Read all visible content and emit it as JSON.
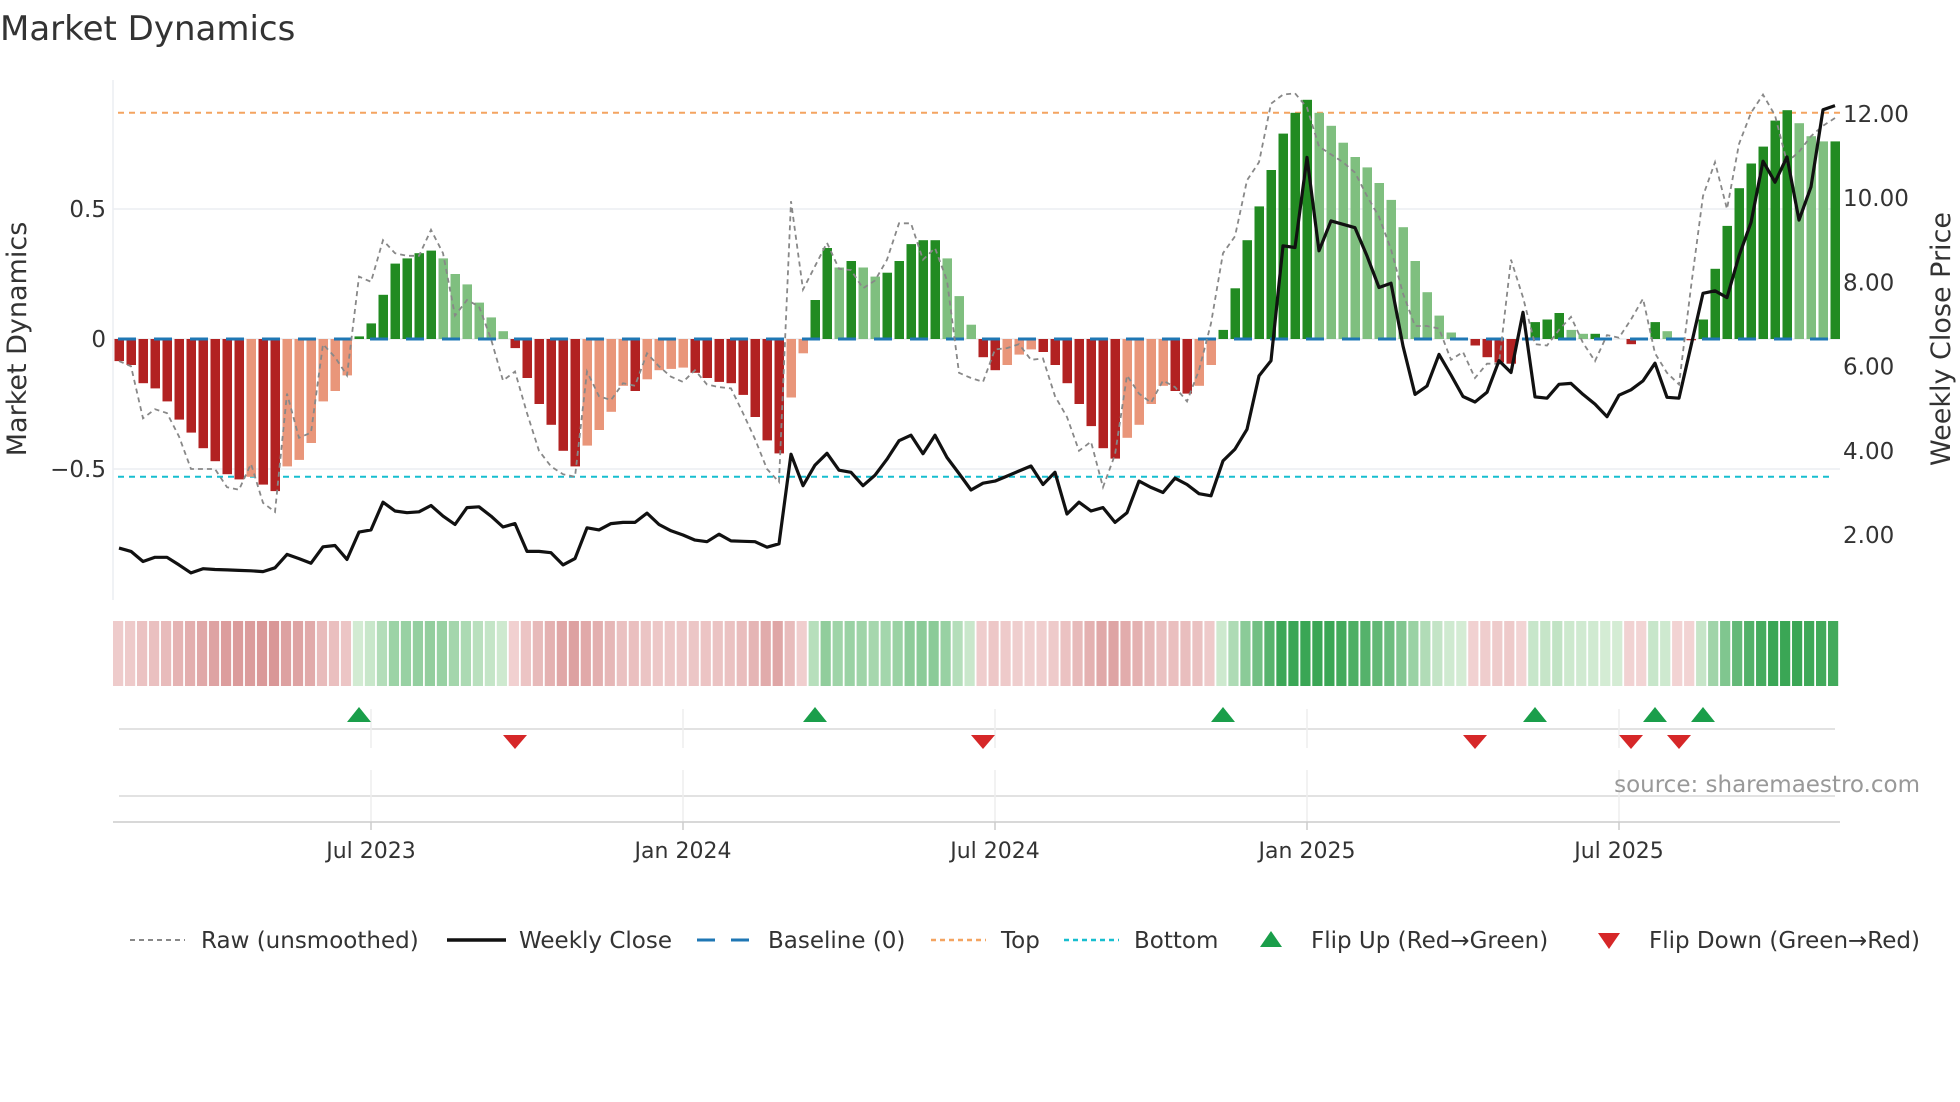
{
  "chart_data": {
    "type": "bar",
    "title": "Market Dynamics",
    "ylabel": "Market Dynamics",
    "y2label": "Weekly Close Price",
    "ylim": [
      -1.0,
      1.05
    ],
    "y2lim": [
      0.6,
      12.5
    ],
    "yticks": [
      {
        "v": 0.5,
        "label": "0.5"
      },
      {
        "v": 0,
        "label": "0"
      },
      {
        "v": -0.5,
        "label": "−0.5"
      }
    ],
    "y2ticks": [
      {
        "v": 12,
        "label": "12.00"
      },
      {
        "v": 10,
        "label": "10.00"
      },
      {
        "v": 8,
        "label": "8.00"
      },
      {
        "v": 6,
        "label": "6.00"
      },
      {
        "v": 4,
        "label": "4.00"
      },
      {
        "v": 2,
        "label": "2.00"
      }
    ],
    "xticks": [
      {
        "week": 22,
        "label": "Jul 2023"
      },
      {
        "week": 48,
        "label": "Jan 2024"
      },
      {
        "week": 74,
        "label": "Jul 2024"
      },
      {
        "week": 100,
        "label": "Jan 2025"
      },
      {
        "week": 126,
        "label": "Jul 2025"
      }
    ],
    "top_level": 0.87,
    "bottom_level": -0.53,
    "smoothed": [
      -0.085,
      -0.1,
      -0.17,
      -0.19,
      -0.24,
      -0.31,
      -0.36,
      -0.42,
      -0.47,
      -0.52,
      -0.54,
      -0.53,
      -0.56,
      -0.585,
      -0.49,
      -0.465,
      -0.4,
      -0.24,
      -0.2,
      -0.14,
      0.01,
      0.06,
      0.17,
      0.29,
      0.31,
      0.33,
      0.34,
      0.31,
      0.25,
      0.21,
      0.14,
      0.083,
      0.03,
      -0.035,
      -0.15,
      -0.25,
      -0.33,
      -0.43,
      -0.49,
      -0.41,
      -0.35,
      -0.28,
      -0.18,
      -0.2,
      -0.155,
      -0.12,
      -0.115,
      -0.11,
      -0.13,
      -0.15,
      -0.165,
      -0.17,
      -0.215,
      -0.3,
      -0.39,
      -0.44,
      -0.225,
      -0.055,
      0.15,
      0.35,
      0.275,
      0.3,
      0.275,
      0.24,
      0.255,
      0.3,
      0.365,
      0.38,
      0.38,
      0.31,
      0.165,
      0.055,
      -0.07,
      -0.12,
      -0.1,
      -0.06,
      -0.04,
      -0.05,
      -0.1,
      -0.17,
      -0.25,
      -0.335,
      -0.42,
      -0.46,
      -0.38,
      -0.33,
      -0.25,
      -0.18,
      -0.2,
      -0.21,
      -0.18,
      -0.1,
      0.035,
      0.195,
      0.38,
      0.51,
      0.65,
      0.79,
      0.87,
      0.92,
      0.87,
      0.82,
      0.755,
      0.7,
      0.66,
      0.6,
      0.535,
      0.43,
      0.3,
      0.18,
      0.09,
      0.025,
      0,
      -0.025,
      -0.07,
      -0.09,
      -0.095,
      0,
      0.065,
      0.075,
      0.1,
      0.035,
      0.02,
      0.02,
      0,
      0,
      -0.02,
      0,
      0.065,
      0.03,
      -0.005,
      -0.005,
      0.075,
      0.27,
      0.435,
      0.58,
      0.675,
      0.74,
      0.84,
      0.88,
      0.83,
      0.78,
      0.76,
      0.76
    ],
    "raw": [
      -0.085,
      -0.105,
      -0.305,
      -0.27,
      -0.285,
      -0.375,
      -0.5,
      -0.5,
      -0.5,
      -0.57,
      -0.58,
      -0.48,
      -0.63,
      -0.665,
      -0.21,
      -0.38,
      -0.36,
      -0.02,
      -0.07,
      -0.14,
      0.24,
      0.22,
      0.38,
      0.33,
      0.32,
      0.32,
      0.42,
      0.33,
      0.09,
      0.15,
      0.125,
      0,
      -0.16,
      -0.125,
      -0.285,
      -0.43,
      -0.49,
      -0.52,
      -0.53,
      -0.125,
      -0.22,
      -0.235,
      -0.17,
      -0.18,
      -0.055,
      -0.105,
      -0.145,
      -0.165,
      -0.12,
      -0.175,
      -0.185,
      -0.19,
      -0.285,
      -0.385,
      -0.5,
      -0.55,
      0.53,
      0.19,
      0.28,
      0.37,
      0.27,
      0.265,
      0.195,
      0.225,
      0.305,
      0.445,
      0.445,
      0.305,
      0.35,
      0.225,
      -0.13,
      -0.15,
      -0.165,
      -0.04,
      -0.035,
      -0.02,
      -0.08,
      -0.075,
      -0.22,
      -0.3,
      -0.43,
      -0.395,
      -0.57,
      -0.445,
      -0.14,
      -0.21,
      -0.245,
      -0.16,
      -0.185,
      -0.24,
      -0.12,
      0.06,
      0.33,
      0.395,
      0.61,
      0.68,
      0.905,
      0.94,
      0.945,
      0.89,
      0.74,
      0.71,
      0.68,
      0.64,
      0.55,
      0.47,
      0.345,
      0.175,
      0.05,
      0.05,
      0.04,
      -0.08,
      -0.05,
      -0.15,
      -0.095,
      -0.095,
      0.305,
      0.16,
      -0.02,
      -0.025,
      0.035,
      0.085,
      -0.015,
      -0.085,
      0.015,
      0.005,
      0.075,
      0.155,
      -0.055,
      -0.13,
      -0.175,
      0.2,
      0.55,
      0.68,
      0.5,
      0.75,
      0.87,
      0.94,
      0.86,
      0.68,
      0.72,
      0.78,
      0.82,
      0.85
    ],
    "weekly_close": [
      1.69,
      1.61,
      1.37,
      1.47,
      1.47,
      1.29,
      1.1,
      1.2,
      1.18,
      1.17,
      1.16,
      1.15,
      1.13,
      1.22,
      1.54,
      1.44,
      1.33,
      1.72,
      1.75,
      1.42,
      2.07,
      2.12,
      2.78,
      2.57,
      2.53,
      2.55,
      2.7,
      2.45,
      2.25,
      2.65,
      2.67,
      2.45,
      2.19,
      2.27,
      1.61,
      1.61,
      1.58,
      1.29,
      1.44,
      2.17,
      2.12,
      2.27,
      2.3,
      2.3,
      2.52,
      2.25,
      2.1,
      2.0,
      1.88,
      1.84,
      2.02,
      1.86,
      1.85,
      1.84,
      1.71,
      1.79,
      3.92,
      3.17,
      3.66,
      3.94,
      3.54,
      3.49,
      3.17,
      3.42,
      3.8,
      4.24,
      4.37,
      3.93,
      4.37,
      3.84,
      3.46,
      3.07,
      3.23,
      3.28,
      3.4,
      3.52,
      3.64,
      3.2,
      3.49,
      2.5,
      2.78,
      2.57,
      2.65,
      2.3,
      2.53,
      3.28,
      3.13,
      3.01,
      3.35,
      3.2,
      2.98,
      2.93,
      3.76,
      4.04,
      4.51,
      5.78,
      6.14,
      8.87,
      8.83,
      10.97,
      8.75,
      9.46,
      9.38,
      9.3,
      8.63,
      7.88,
      7.98,
      6.49,
      5.34,
      5.54,
      6.29,
      5.8,
      5.29,
      5.16,
      5.39,
      6.14,
      5.86,
      7.29,
      5.28,
      5.25,
      5.58,
      5.6,
      5.34,
      5.11,
      4.81,
      5.32,
      5.45,
      5.66,
      6.08,
      5.27,
      5.25,
      6.49,
      7.74,
      7.8,
      7.64,
      8.63,
      9.42,
      10.88,
      10.38,
      10.98,
      9.48,
      10.27,
      12.1,
      12.2
    ],
    "flip_up_weeks": [
      21,
      59,
      93,
      119,
      129,
      133
    ],
    "flip_down_weeks": [
      34,
      73,
      114,
      127,
      131
    ],
    "legend": {
      "raw": "Raw (unsmoothed)",
      "close": "Weekly Close",
      "baseline": "Baseline (0)",
      "top": "Top",
      "bottom": "Bottom",
      "flip_up": "Flip Up (Red→Green)",
      "flip_down": "Flip Down (Green→Red)"
    },
    "legend_placement": "bottom",
    "grid": true,
    "source": "source: sharemaestro.com"
  },
  "colors": {
    "red_strong": "#b22222",
    "red_weak": "#e9967a",
    "green_strong": "#228b22",
    "green_weak": "#7fbf7f",
    "baseline": "#1f77b4",
    "top": "#f4a460",
    "bottom": "#17becf",
    "raw": "#888888",
    "close": "#111111",
    "flip_up": "#1a9e4a",
    "flip_down": "#d62728"
  }
}
